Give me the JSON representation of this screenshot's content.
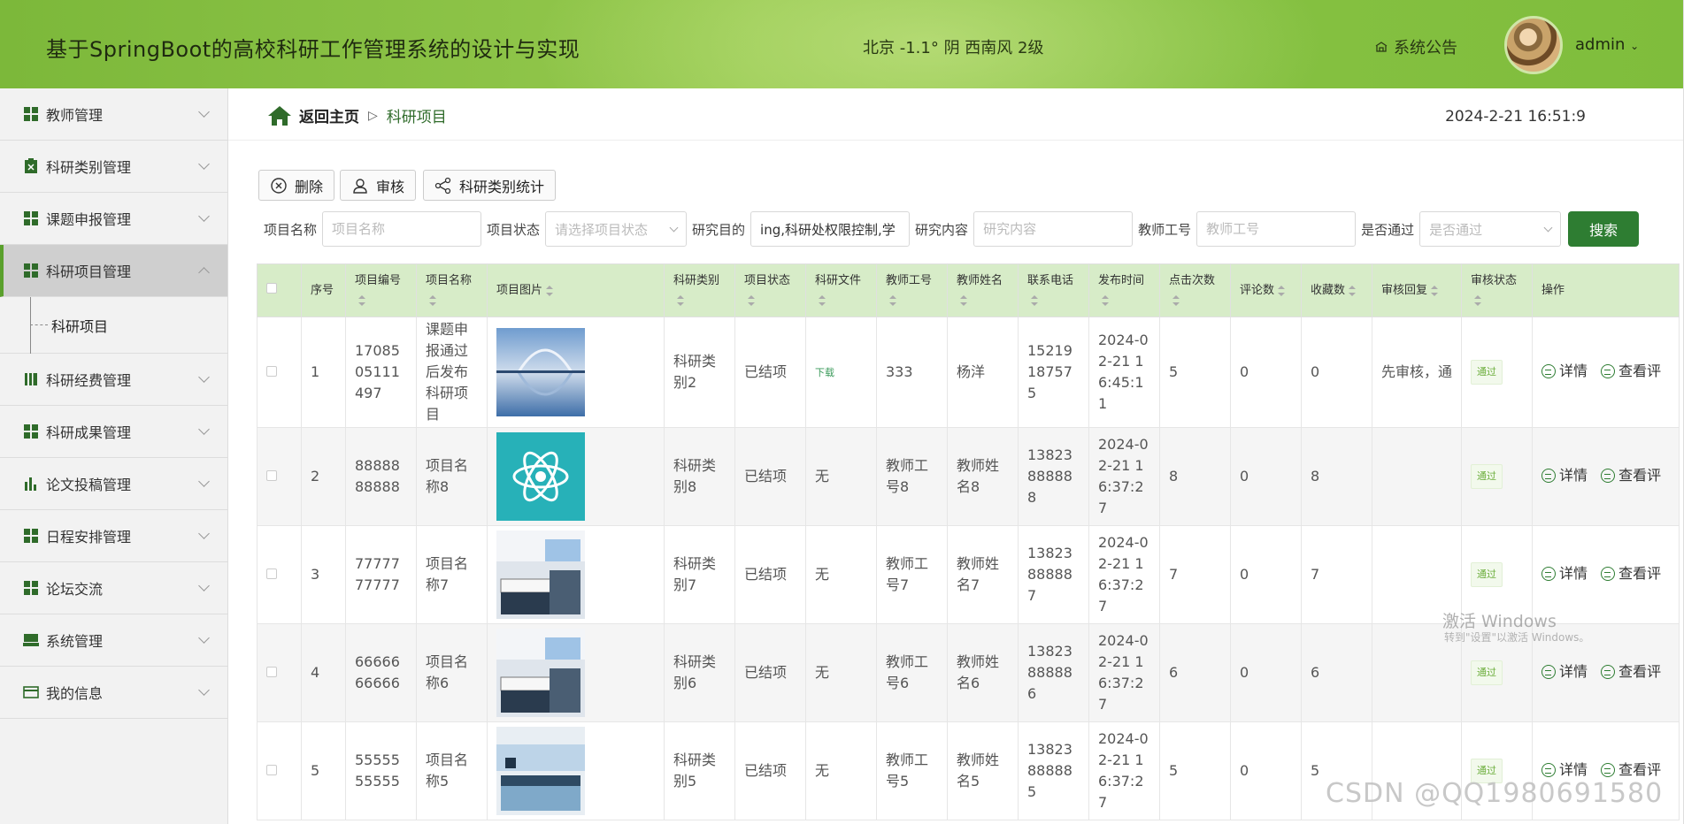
{
  "header": {
    "app_title": "基于SpringBoot的高校科研工作管理系统的设计与实现",
    "weather": "北京  -1.1°  阴  西南风  2级",
    "notice_label": "系统公告",
    "user_name": "admin"
  },
  "sidebar": {
    "items": [
      {
        "label": "教师管理",
        "icon": "grid-icon"
      },
      {
        "label": "科研类别管理",
        "icon": "clipboard-icon"
      },
      {
        "label": "课题申报管理",
        "icon": "grid-icon"
      },
      {
        "label": "科研项目管理",
        "icon": "grid-icon"
      },
      {
        "label": "科研经费管理",
        "icon": "ledger-icon"
      },
      {
        "label": "科研成果管理",
        "icon": "grid-icon"
      },
      {
        "label": "论文投稿管理",
        "icon": "bar-chart-icon"
      },
      {
        "label": "日程安排管理",
        "icon": "grid-icon"
      },
      {
        "label": "论坛交流",
        "icon": "grid-icon"
      },
      {
        "label": "系统管理",
        "icon": "monitor-icon"
      },
      {
        "label": "我的信息",
        "icon": "card-icon"
      }
    ],
    "sub_item": "科研项目"
  },
  "breadcrumb": {
    "home": "返回主页",
    "current": "科研项目"
  },
  "clock": "2024-2-21 16:51:9",
  "toolbar": {
    "delete": "删除",
    "review": "审核",
    "stats": "科研类别统计"
  },
  "search": {
    "name_label": "项目名称",
    "name_placeholder": "项目名称",
    "status_label": "项目状态",
    "status_placeholder": "请选择项目状态",
    "purpose_label": "研究目的",
    "purpose_value": "ing,科研处权限控制,学",
    "content_label": "研究内容",
    "content_placeholder": "研究内容",
    "teacher_label": "教师工号",
    "teacher_placeholder": "教师工号",
    "pass_label": "是否通过",
    "pass_placeholder": "是否通过",
    "button": "搜索"
  },
  "table": {
    "headers": [
      "序号",
      "项目编号",
      "项目名称",
      "项目图片",
      "科研类别",
      "项目状态",
      "科研文件",
      "教师工号",
      "教师姓名",
      "联系电话",
      "发布时间",
      "点击次数",
      "评论数",
      "收藏数",
      "审核回复",
      "审核状态",
      "操作"
    ],
    "rows": [
      {
        "idx": "1",
        "code": "1708505111497",
        "name": "课题申报通过后发布科研项目",
        "img": "bridge",
        "cat": "科研类别2",
        "status": "已结项",
        "file": "下载",
        "tid": "333",
        "tname": "杨洋",
        "phone": "15219187575",
        "time": "2024-02-21 16:45:11",
        "clicks": "5",
        "comments": "0",
        "favs": "0",
        "reply": "先审核，通",
        "audit": "通过"
      },
      {
        "idx": "2",
        "code": "8888888888",
        "name": "项目名称8",
        "img": "atom",
        "cat": "科研类别8",
        "status": "已结项",
        "file": "无",
        "tid": "教师工号8",
        "tname": "教师姓名8",
        "phone": "13823888888",
        "time": "2024-02-21 16:37:27",
        "clicks": "8",
        "comments": "0",
        "favs": "8",
        "reply": "",
        "audit": "通过"
      },
      {
        "idx": "3",
        "code": "7777777777",
        "name": "项目名称7",
        "img": "lab",
        "cat": "科研类别7",
        "status": "已结项",
        "file": "无",
        "tid": "教师工号7",
        "tname": "教师姓名7",
        "phone": "13823888887",
        "time": "2024-02-21 16:37:27",
        "clicks": "7",
        "comments": "0",
        "favs": "7",
        "reply": "",
        "audit": "通过"
      },
      {
        "idx": "4",
        "code": "6666666666",
        "name": "项目名称6",
        "img": "lab",
        "cat": "科研类别6",
        "status": "已结项",
        "file": "无",
        "tid": "教师工号6",
        "tname": "教师姓名6",
        "phone": "13823888886",
        "time": "2024-02-21 16:37:27",
        "clicks": "6",
        "comments": "0",
        "favs": "6",
        "reply": "",
        "audit": "通过"
      },
      {
        "idx": "5",
        "code": "5555555555",
        "name": "项目名称5",
        "img": "lab2",
        "cat": "科研类别5",
        "status": "已结项",
        "file": "无",
        "tid": "教师工号5",
        "tname": "教师姓名5",
        "phone": "13823888885",
        "time": "2024-02-21 16:37:27",
        "clicks": "5",
        "comments": "0",
        "favs": "5",
        "reply": "",
        "audit": "通过"
      }
    ],
    "op_detail": "详情",
    "op_review": "查看评"
  },
  "watermark": {
    "win1": "激活 Windows",
    "win2": "转到\"设置\"以激活 Windows。",
    "csdn": "CSDN @QQ1980691580"
  },
  "colors": {
    "header": "#86c142",
    "accent": "#2e7d32",
    "table_header": "#d7ecc8"
  }
}
